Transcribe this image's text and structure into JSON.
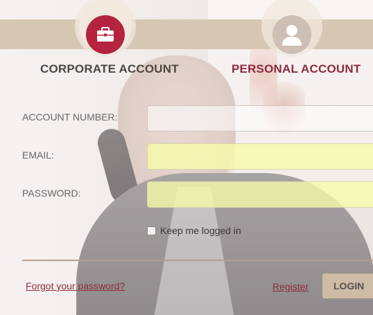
{
  "tabs": {
    "corporate": {
      "label": "CORPORATE ACCOUNT",
      "icon": "briefcase-icon",
      "active": true
    },
    "personal": {
      "label": "PERSONAL ACCOUNT",
      "icon": "user-icon",
      "active": false
    }
  },
  "form": {
    "account_number": {
      "label": "ACCOUNT NUMBER:",
      "value": "",
      "placeholder": ""
    },
    "email": {
      "label": "EMAIL:",
      "value": "",
      "placeholder": ""
    },
    "password": {
      "label": "PASSWORD:",
      "value": "",
      "placeholder": ""
    },
    "keep_logged_in": {
      "label": "Keep me logged in",
      "checked": false
    }
  },
  "actions": {
    "forgot_password": "Forgot your password?",
    "register": "Register",
    "login": "LOGIN"
  },
  "colors": {
    "accent": "#b4243f",
    "link": "#8e2b3d",
    "tab_band": "#d6c7b3",
    "autofill": "#f6fca8"
  }
}
